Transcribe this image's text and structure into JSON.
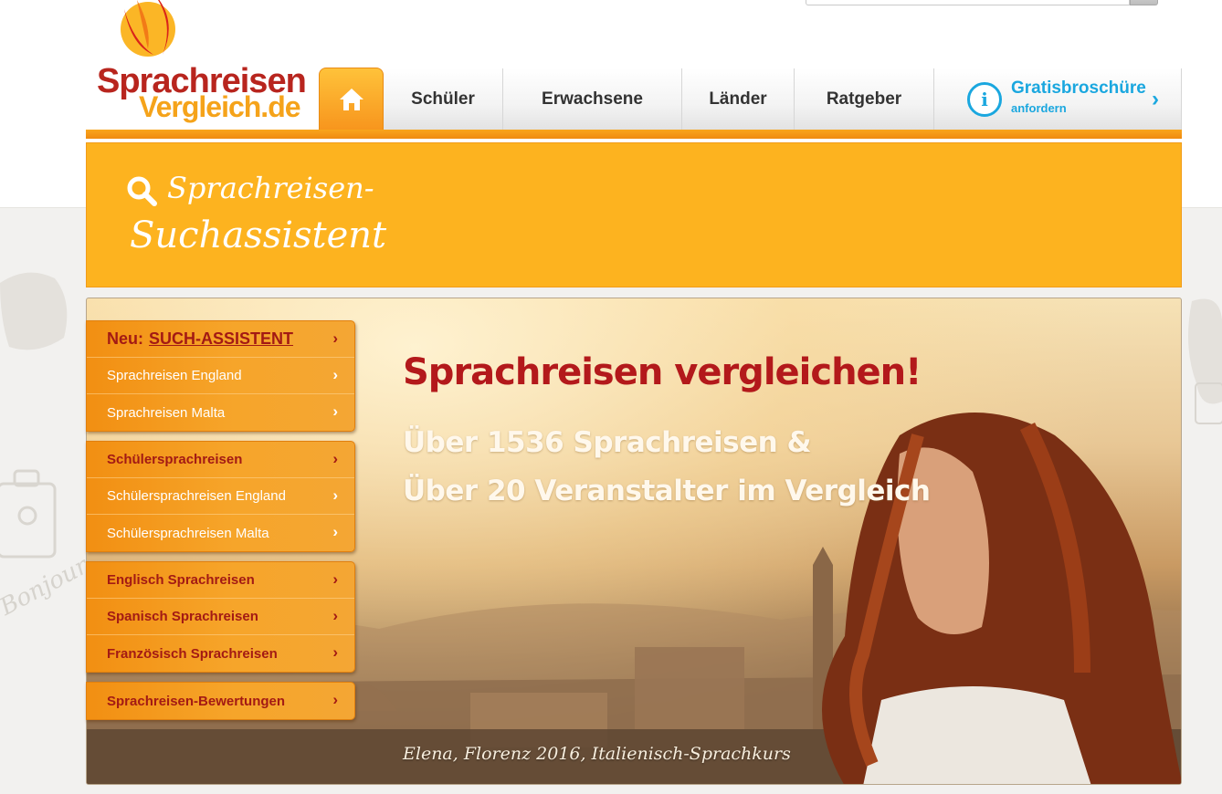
{
  "header": {
    "logo": {
      "line1": "Sprachreisen",
      "line2": "Vergleich.de"
    },
    "search": {
      "placeholder": ""
    }
  },
  "nav": {
    "items": [
      {
        "label": "Schüler"
      },
      {
        "label": "Erwachsene"
      },
      {
        "label": "Länder"
      },
      {
        "label": "Ratgeber"
      }
    ],
    "cta": {
      "title": "Gratisbroschüre",
      "subtitle": "anfordern"
    }
  },
  "banner": {
    "line1": "Sprachreisen-",
    "line2": "Suchassistent"
  },
  "menu": {
    "group1": {
      "headline_prefix": "Neu:",
      "headline_link": "SUCH-ASSISTENT",
      "items": [
        "Sprachreisen England",
        "Sprachreisen Malta"
      ]
    },
    "group2": {
      "title": "Schülersprachreisen",
      "items": [
        "Schülersprachreisen England",
        "Schülersprachreisen Malta"
      ]
    },
    "group3": {
      "items": [
        "Englisch Sprachreisen",
        "Spanisch Sprachreisen",
        "Französisch Sprachreisen"
      ]
    },
    "group4": {
      "items": [
        "Sprachreisen-Bewertungen"
      ]
    }
  },
  "hero": {
    "title": "Sprachreisen vergleichen!",
    "line1": "Über 1536 Sprachreisen &",
    "line2": "Über 20 Veranstalter im Vergleich",
    "caption": "Elena, Florenz 2016, Italienisch-Sprachkurs"
  },
  "background": {
    "doodle_text": "Bonjour"
  },
  "colors": {
    "brand_red": "#b8251e",
    "brand_orange": "#f7951d",
    "banner_yellow": "#fdb31f",
    "cta_blue": "#1aa7df"
  }
}
